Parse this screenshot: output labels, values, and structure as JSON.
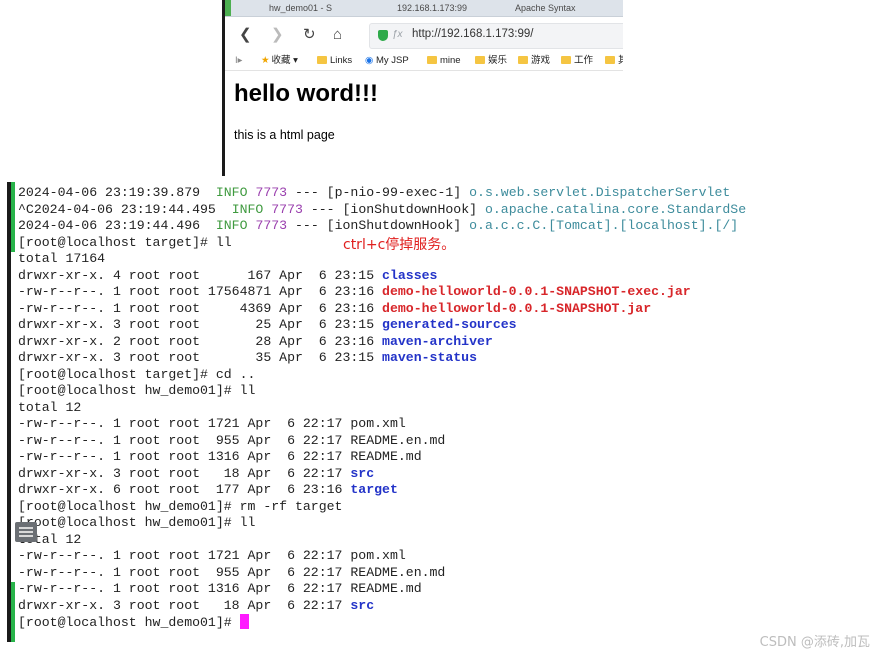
{
  "browser": {
    "tabs": [
      "hw_demo01 - S",
      "192.168.1.173:99",
      "Apache Syntax"
    ],
    "url": "http://192.168.1.173:99/",
    "url_prefix_icon": "shield-icon",
    "bookmarks": [
      "收藏",
      "Links",
      "My JSP",
      "mine",
      "娱乐",
      "游戏",
      "工作",
      "其"
    ],
    "page_heading": "hello word!!!",
    "page_text": "this is a html page"
  },
  "terminal": {
    "lines": [
      [
        {
          "t": "2024-04-06 23:19:39.879  "
        },
        {
          "t": "INFO",
          "c": "g"
        },
        {
          "t": " "
        },
        {
          "t": "7773",
          "c": "pu"
        },
        {
          "t": " --- [p-nio-99-exec-1] "
        },
        {
          "t": "o.s.web.servlet.DispatcherServlet",
          "c": "cy"
        }
      ],
      [
        {
          "t": "^C2024-04-06 23:19:44.495  "
        },
        {
          "t": "INFO",
          "c": "g"
        },
        {
          "t": " "
        },
        {
          "t": "7773",
          "c": "pu"
        },
        {
          "t": " --- [ionShutdownHook] "
        },
        {
          "t": "o.apache.catalina.core.StandardSe",
          "c": "cy"
        }
      ],
      [
        {
          "t": "2024-04-06 23:19:44.496  "
        },
        {
          "t": "INFO",
          "c": "g"
        },
        {
          "t": " "
        },
        {
          "t": "7773",
          "c": "pu"
        },
        {
          "t": " --- [ionShutdownHook] "
        },
        {
          "t": "o.a.c.c.C.[Tomcat].[localhost].[/]",
          "c": "cy"
        }
      ],
      [
        {
          "t": "[root@localhost target]# ll"
        }
      ],
      [
        {
          "t": "total 17164"
        }
      ],
      [
        {
          "t": "drwxr-xr-x. 4 root root      167 Apr  6 23:15 "
        },
        {
          "t": "classes",
          "c": "bl"
        }
      ],
      [
        {
          "t": "-rw-r--r--. 1 root root 17564871 Apr  6 23:16 "
        },
        {
          "t": "demo-helloworld-0.0.1-SNAPSHOT-exec.jar",
          "c": "rd"
        }
      ],
      [
        {
          "t": "-rw-r--r--. 1 root root     4369 Apr  6 23:16 "
        },
        {
          "t": "demo-helloworld-0.0.1-SNAPSHOT.jar",
          "c": "rd"
        }
      ],
      [
        {
          "t": "drwxr-xr-x. 3 root root       25 Apr  6 23:15 "
        },
        {
          "t": "generated-sources",
          "c": "bl"
        }
      ],
      [
        {
          "t": "drwxr-xr-x. 2 root root       28 Apr  6 23:16 "
        },
        {
          "t": "maven-archiver",
          "c": "bl"
        }
      ],
      [
        {
          "t": "drwxr-xr-x. 3 root root       35 Apr  6 23:15 "
        },
        {
          "t": "maven-status",
          "c": "bl"
        }
      ],
      [
        {
          "t": "[root@localhost target]# cd .."
        }
      ],
      [
        {
          "t": "[root@localhost hw_demo01]# ll"
        }
      ],
      [
        {
          "t": "total 12"
        }
      ],
      [
        {
          "t": "-rw-r--r--. 1 root root 1721 Apr  6 22:17 pom.xml"
        }
      ],
      [
        {
          "t": "-rw-r--r--. 1 root root  955 Apr  6 22:17 README.en.md"
        }
      ],
      [
        {
          "t": "-rw-r--r--. 1 root root 1316 Apr  6 22:17 README.md"
        }
      ],
      [
        {
          "t": "drwxr-xr-x. 3 root root   18 Apr  6 22:17 "
        },
        {
          "t": "src",
          "c": "bl"
        }
      ],
      [
        {
          "t": "drwxr-xr-x. 6 root root  177 Apr  6 23:16 "
        },
        {
          "t": "target",
          "c": "bl"
        }
      ],
      [
        {
          "t": "[root@localhost hw_demo01]# rm -rf target"
        }
      ],
      [
        {
          "t": "[root@localhost hw_demo01]# ll"
        }
      ],
      [
        {
          "t": "total 12"
        }
      ],
      [
        {
          "t": "-rw-r--r--. 1 root root 1721 Apr  6 22:17 pom.xml"
        }
      ],
      [
        {
          "t": "-rw-r--r--. 1 root root  955 Apr  6 22:17 README.en.md"
        }
      ],
      [
        {
          "t": "-rw-r--r--. 1 root root 1316 Apr  6 22:17 README.md"
        }
      ],
      [
        {
          "t": "drwxr-xr-x. 3 root root   18 Apr  6 22:17 "
        },
        {
          "t": "src",
          "c": "bl"
        }
      ],
      [
        {
          "t": "[root@localhost hw_demo01]# "
        }
      ]
    ],
    "annotation": "ctrl+c停掉服务。",
    "colors": {
      "info": "#3f9a3f",
      "pid": "#9a3fae",
      "logger": "#3e8c9c",
      "dir": "#2333c8",
      "jar": "#d8262a",
      "cursor": "#ff1aff",
      "annotation": "#e0201f"
    }
  },
  "watermark": "CSDN @添砖,加瓦"
}
